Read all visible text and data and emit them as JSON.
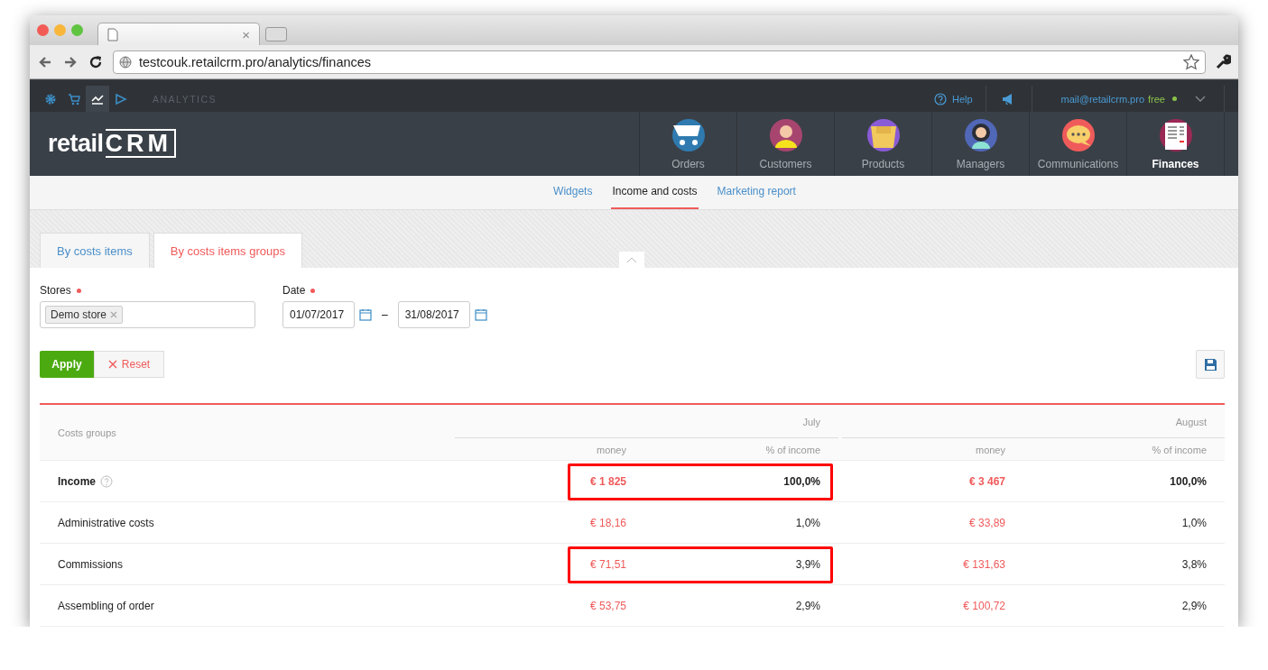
{
  "browser": {
    "tab_close": "×",
    "address": "testcouk.retailcrm.pro/analytics/finances"
  },
  "topbar": {
    "section": "ANALYTICS",
    "help": "Help",
    "email": "mail@retailcrm.pro",
    "plan": "free"
  },
  "logo": {
    "text": "retail",
    "mark": "CRM"
  },
  "nav": [
    {
      "label": "Orders",
      "kind": "cart",
      "selected": false
    },
    {
      "label": "Customers",
      "kind": "person",
      "selected": false
    },
    {
      "label": "Products",
      "kind": "box",
      "selected": false
    },
    {
      "label": "Managers",
      "kind": "person2",
      "selected": false
    },
    {
      "label": "Communications",
      "kind": "chat",
      "selected": false
    },
    {
      "label": "Finances",
      "kind": "sheet",
      "selected": true
    }
  ],
  "subnav": [
    {
      "label": "Widgets",
      "selected": false
    },
    {
      "label": "Income and costs",
      "selected": true
    },
    {
      "label": "Marketing report",
      "selected": false
    }
  ],
  "tabs": [
    {
      "label": "By costs items",
      "selected": false
    },
    {
      "label": "By costs items groups",
      "selected": true
    }
  ],
  "filters": {
    "stores_label": "Stores",
    "store_tag": "Demo store",
    "date_label": "Date",
    "date_from": "01/07/2017",
    "separator": "–",
    "date_to": "31/08/2017"
  },
  "buttons": {
    "apply": "Apply",
    "reset": "Reset"
  },
  "table": {
    "first_column": "Costs groups",
    "periods": [
      "July",
      "August"
    ],
    "subcolumns": [
      "money",
      "% of income",
      "money",
      "% of income"
    ],
    "rows": [
      {
        "name": "Income",
        "bold": true,
        "help": true,
        "highlighted": true,
        "cells": [
          "€ 1 825",
          "100,0%",
          "€ 3 467",
          "100,0%"
        ]
      },
      {
        "name": "Administrative costs",
        "bold": false,
        "help": false,
        "highlighted": false,
        "cells": [
          "€ 18,16",
          "1,0%",
          "€ 33,89",
          "1,0%"
        ]
      },
      {
        "name": "Commissions",
        "bold": false,
        "help": false,
        "highlighted": true,
        "cells": [
          "€ 71,51",
          "3,9%",
          "€ 131,63",
          "3,8%"
        ]
      },
      {
        "name": "Assembling of order",
        "bold": false,
        "help": false,
        "highlighted": false,
        "cells": [
          "€ 53,75",
          "2,9%",
          "€ 100,72",
          "2,9%"
        ]
      }
    ]
  }
}
